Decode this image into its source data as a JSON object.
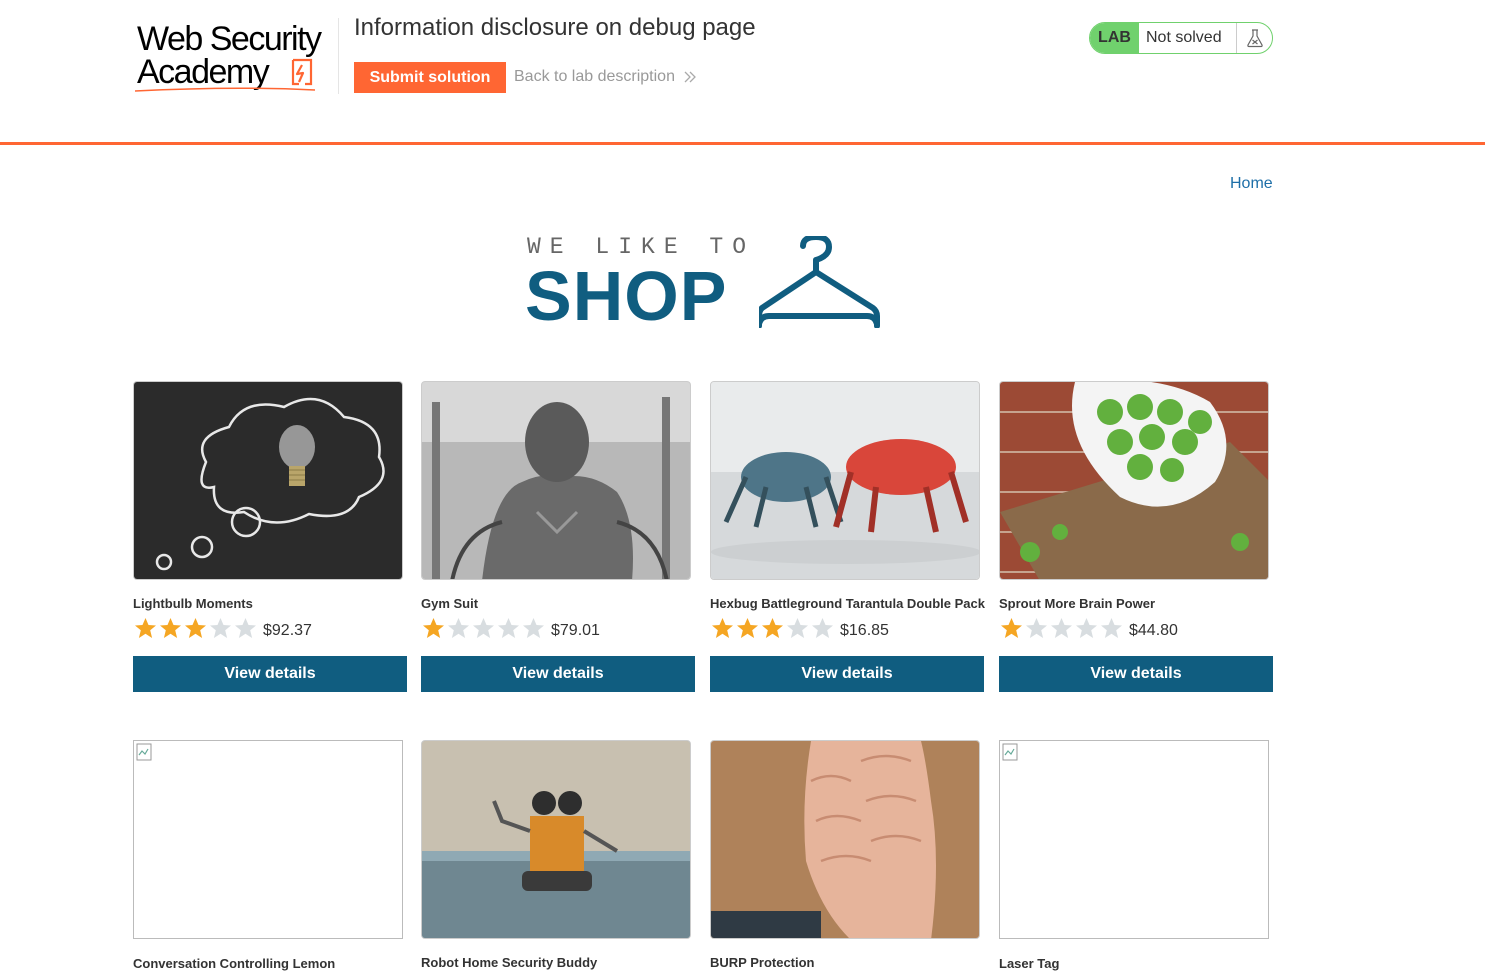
{
  "lab_header": {
    "logo_line1": "Web Security",
    "logo_line2": "Academy",
    "title": "Information disclosure on debug page",
    "submit_label": "Submit solution",
    "back_label": "Back to lab description",
    "back_chevron": "»",
    "status_tag": "LAB",
    "status_text": "Not solved",
    "flask_icon": "flask-icon"
  },
  "nav": {
    "home_label": "Home"
  },
  "banner": {
    "tagline": "WE LIKE TO",
    "shop_word": "SHOP",
    "hanger_icon": "hanger-icon"
  },
  "colors": {
    "accent_orange": "#ff6633",
    "brand_blue": "#105d80",
    "link_blue": "#1e6fa8",
    "status_green": "#70d16d",
    "star_gold": "#f5a623",
    "star_grey": "#d8dde0"
  },
  "products": [
    {
      "name": "Lightbulb Moments",
      "rating": 3,
      "price": "$92.37",
      "button": "View details",
      "image": "lightbulb"
    },
    {
      "name": "Gym Suit",
      "rating": 1,
      "price": "$79.01",
      "button": "View details",
      "image": "gym"
    },
    {
      "name": "Hexbug Battleground Tarantula Double Pack",
      "rating": 3,
      "price": "$16.85",
      "button": "View details",
      "image": "hexbug"
    },
    {
      "name": "Sprout More Brain Power",
      "rating": 1,
      "price": "$44.80",
      "button": "View details",
      "image": "sprouts"
    },
    {
      "name": "Conversation Controlling Lemon",
      "rating": 0,
      "price": "",
      "button": "",
      "image": "broken"
    },
    {
      "name": "Robot Home Security Buddy",
      "rating": 0,
      "price": "",
      "button": "",
      "image": "robot"
    },
    {
      "name": "BURP Protection",
      "rating": 0,
      "price": "",
      "button": "",
      "image": "beard"
    },
    {
      "name": "Laser Tag",
      "rating": 0,
      "price": "",
      "button": "",
      "image": "broken"
    }
  ]
}
